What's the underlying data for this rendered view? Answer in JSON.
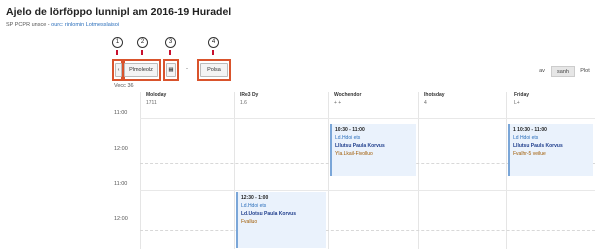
{
  "page": {
    "title": "Ajelo de lörföppo lunnipl am 2016-19 Huradel",
    "subtitle_prefix": "SP PCPR unsce",
    "subtitle_link": "ourc: rinlomin Lotmesslaisoi"
  },
  "callouts": [
    "1",
    "2",
    "3",
    "4"
  ],
  "toolbar": {
    "today_label": "Plmoleolz",
    "calendar_icon": "calendar-icon",
    "separator": "-",
    "filter_label": "Polsa"
  },
  "views": {
    "day": "av",
    "week": "sanh",
    "month": "Plot"
  },
  "week_label": "Vecc 36",
  "days": [
    {
      "name": "Moloday",
      "date": "1711"
    },
    {
      "name": "IRe3 Dy",
      "date": "1.6"
    },
    {
      "name": "Wochendor",
      "date": "+ +"
    },
    {
      "name": "Ihotsday",
      "date": "4"
    },
    {
      "name": "Friday",
      "date": "L+"
    }
  ],
  "times": [
    "11:00",
    "12:00",
    "11:00",
    "12:00"
  ],
  "events": [
    {
      "time": "10:30 - 11:00",
      "subject": "Ld.Hdoi ets",
      "teacher": "Lllutsu Paula Korvus",
      "room": "Yla.Lkail-Fivolluo"
    },
    {
      "time": "1 10:30 - 11:00",
      "subject": "Ld Hdoi ets",
      "teacher": "Lllutsu Pauls Korvus",
      "room": "Fvalhr-5 veilue"
    },
    {
      "time": "12:30 - 1:00",
      "subject": "Ld.Hdoi ets",
      "teacher": "Ld.Uotsu Paula Korvus",
      "room": "Fvalluo"
    }
  ],
  "colors": {
    "highlight": "#d9532c",
    "pin": "#c8102e",
    "event_bg": "#eaf2fc",
    "event_border": "#7aa6d8"
  }
}
